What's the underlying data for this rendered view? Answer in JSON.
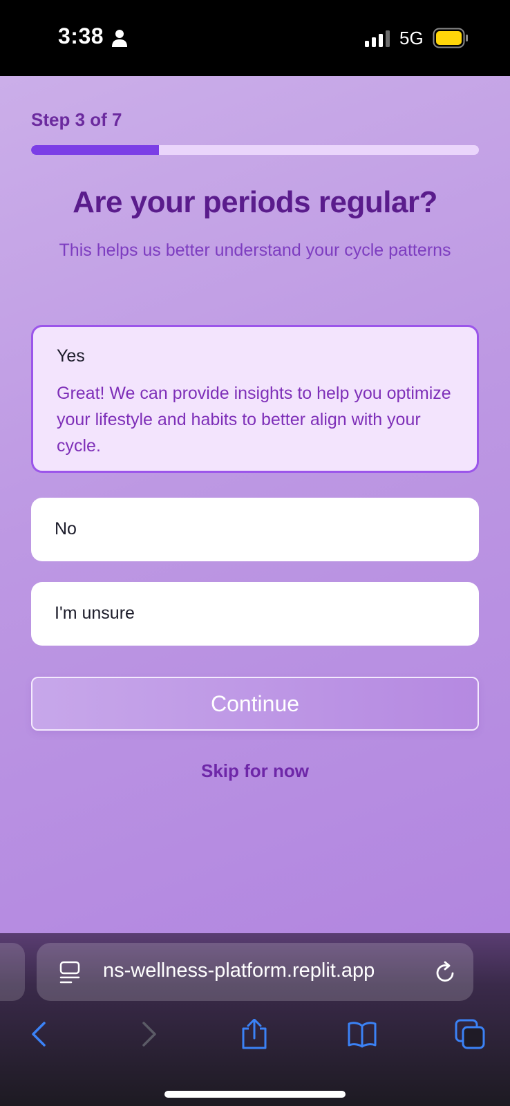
{
  "status_bar": {
    "time": "3:38",
    "network": "5G",
    "battery_color": "#ffd60a"
  },
  "onboarding": {
    "step_label": "Step 3 of 7",
    "progress_fraction": 0.2857,
    "question_title": "Are your periods regular?",
    "question_subtitle": "This helps us better understand your cycle patterns",
    "options": [
      {
        "label": "Yes",
        "description": "Great! We can provide insights to help you optimize your lifestyle and habits to better align with your cycle.",
        "selected": true
      },
      {
        "label": "No",
        "selected": false
      },
      {
        "label": "I'm unsure",
        "selected": false
      }
    ],
    "continue_label": "Continue",
    "skip_label": "Skip for now"
  },
  "browser": {
    "url": "ns-wellness-platform.replit.app",
    "icons": [
      "page-menu-icon",
      "reload-icon",
      "back-icon",
      "forward-icon",
      "share-icon",
      "bookmarks-icon",
      "tabs-icon"
    ],
    "accent": "#3b82f6"
  }
}
